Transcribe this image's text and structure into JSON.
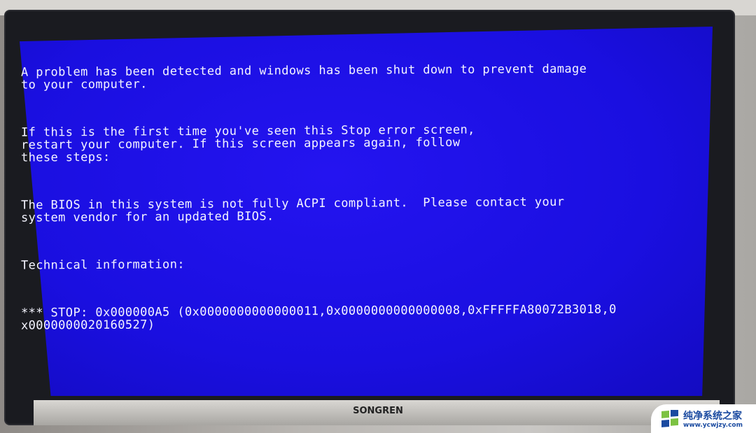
{
  "screen": {
    "background_color": "#1a10e6",
    "text_color": "#f4f4ff",
    "lines": {
      "p1": "A problem has been detected and windows has been shut down to prevent damage\nto your computer.",
      "p2": "If this is the first time you've seen this Stop error screen,\nrestart your computer. If this screen appears again, follow\nthese steps:",
      "p3": "The BIOS in this system is not fully ACPI compliant.  Please contact your\nsystem vendor for an updated BIOS.",
      "p4": "Technical information:",
      "p5": "*** STOP: 0x000000A5 (0x0000000000000011,0x0000000000000008,0xFFFFFA80072B3018,0\nx0000000020160527)"
    }
  },
  "monitor": {
    "brand": "SONGREN"
  },
  "watermark": {
    "title": "纯净系统之家",
    "url": "www.ycwjzy.com"
  }
}
